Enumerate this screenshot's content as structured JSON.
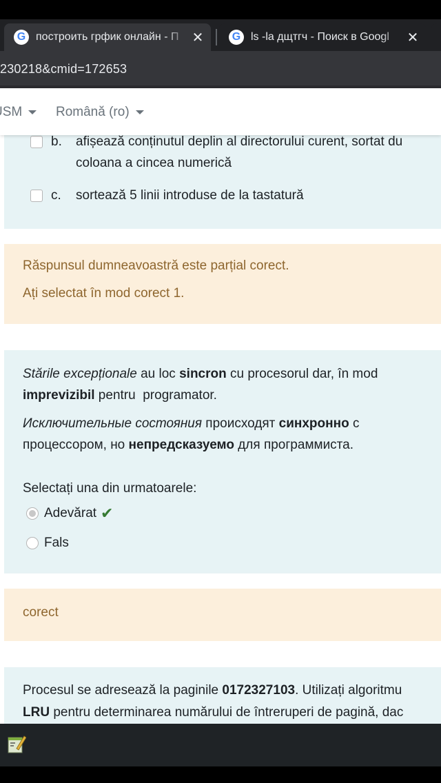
{
  "browser": {
    "tabs": [
      {
        "title": "построить грфик онлайн - П",
        "icon": "google-icon",
        "active": true
      },
      {
        "title": "ls -la дщтгч - Поиск в Googl",
        "icon": "google-icon",
        "active": false
      }
    ],
    "address": "230218&cmid=172653"
  },
  "navbar": {
    "item1": "USM",
    "language": "Română ‎(ro)‎"
  },
  "question1": {
    "options": [
      {
        "letter": "b.",
        "line1": "afișează conținutul deplin al directorului curent, sortat du",
        "line2": "coloana a cincea numerică",
        "checked": false
      },
      {
        "letter": "c.",
        "line1": "sortează 5 linii introduse de la tastatură",
        "checked": false
      }
    ]
  },
  "feedback1": {
    "line1": "Răspunsul dumneavoastră este parțial corect.",
    "line2": "Ați selectat în mod corect 1."
  },
  "question2": {
    "ro": {
      "p1_italic": "Stările excepționale",
      "p1_a": " au loc ",
      "p1_bold": "sincron",
      "p1_b": " cu procesorul dar, în mod",
      "p2_bold": "imprevizibil",
      "p2_a": " pentru  programator."
    },
    "ru": {
      "p1_italic": "Исключительные состояния",
      "p1_a": " происходят ",
      "p1_bold": "синхронно",
      "p1_b": " с",
      "p2_a": "процессором, но ",
      "p2_bold": "непредсказуемо",
      "p2_b": " для программиста."
    },
    "prompt": "Selectați una din urmatoarele:",
    "options": [
      {
        "label": "Adevărat",
        "checked": true,
        "correct_mark": "✔"
      },
      {
        "label": "Fals",
        "checked": false
      }
    ]
  },
  "feedback2": {
    "text": "corect"
  },
  "question3": {
    "a": "Procesul se adresează la paginile ",
    "bold1": "0172327103",
    "b": ". Utilizați algoritmu",
    "bold2": "LRU",
    "c": " pentru determinarea numărului de întreruperi de pagină, dac"
  },
  "colors": {
    "question_bg": "#e7f3f5",
    "feedback_bg": "#fcefdc",
    "feedback_text": "#8e662e",
    "check_green": "#357a32",
    "chrome_dark": "#202124"
  }
}
